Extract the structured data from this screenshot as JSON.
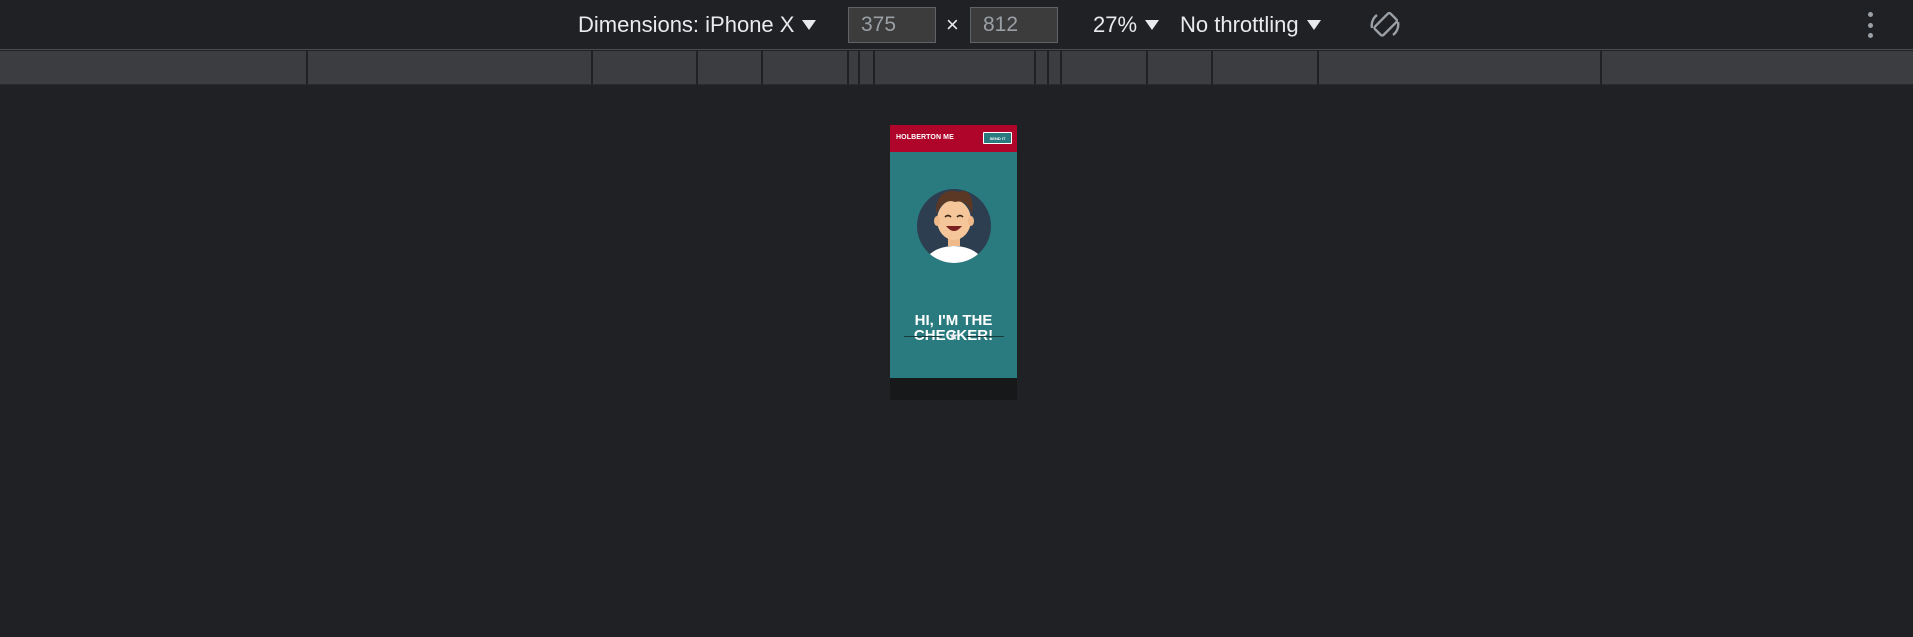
{
  "devtools": {
    "dimensions_label": "Dimensions: iPhone X",
    "width_value": "375",
    "height_value": "812",
    "times_symbol": "×",
    "zoom": "27%",
    "throttling": "No throttling",
    "icons": {
      "rotate": "rotate-icon",
      "more": "more-vert-icon",
      "caret": "caret-down-icon"
    }
  },
  "site": {
    "title": "HOLBERTON ME",
    "button_label": "SEND IT",
    "hero_title_line1": "HI, I'M THE",
    "hero_title_line2": "CHECKER!",
    "colors": {
      "header": "#b0052a",
      "hero": "#2a7b7f"
    }
  }
}
